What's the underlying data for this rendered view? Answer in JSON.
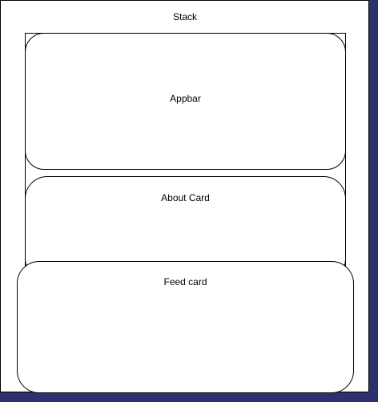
{
  "diagram": {
    "stack_label": "Stack",
    "appbar_label": "Appbar",
    "about_card_label": "About Card",
    "feed_card_label": "Feed card"
  }
}
